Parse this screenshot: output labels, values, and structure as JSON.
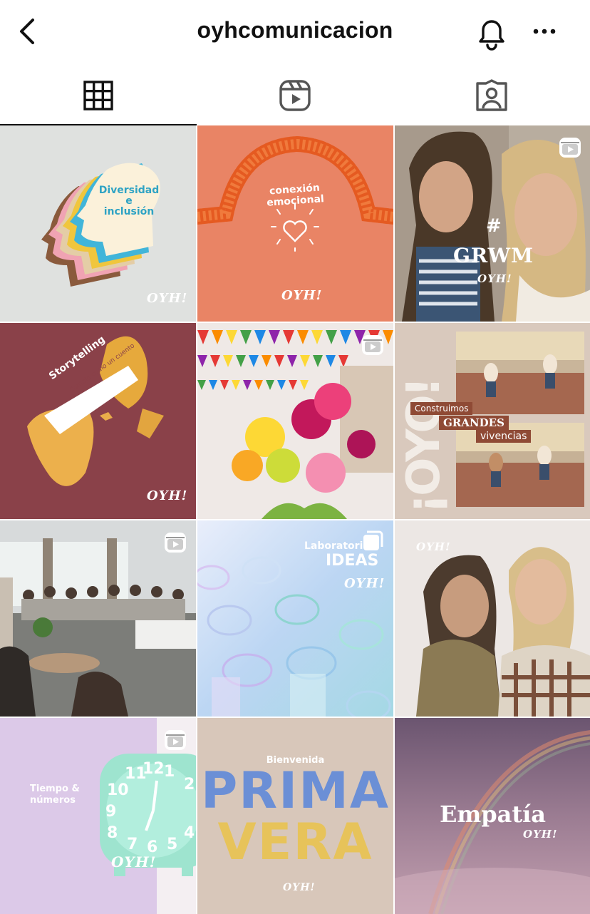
{
  "header": {
    "username": "oyhcomunicacion",
    "back_icon": "back-arrow-icon",
    "bell_icon": "bell-icon",
    "more_icon": "more-horizontal-icon"
  },
  "tabs": [
    {
      "name": "grid",
      "icon": "grid-icon",
      "active": true
    },
    {
      "name": "reels",
      "icon": "reels-icon",
      "active": false
    },
    {
      "name": "tagged",
      "icon": "tagged-user-icon",
      "active": false
    }
  ],
  "posts": {
    "p1": {
      "line1": "Diversidad",
      "line2": "e",
      "line3": "inclusión",
      "brand": "OYH!"
    },
    "p2": {
      "text": "conexión emocional",
      "brand": "OYH!"
    },
    "p3": {
      "hash": "#",
      "text": "GRWM",
      "brand": "OYH!"
    },
    "p4": {
      "text": "Storytelling",
      "sub": "Contalo como un cuento",
      "brand": "OYH!"
    },
    "p5": {},
    "p6": {
      "big": "¡OYO!",
      "l1": "Construimos",
      "l2": "GRANDES",
      "l3": "vivencias"
    },
    "p7": {},
    "p8": {
      "l1": "Laboratorio",
      "l2": "IDEAS",
      "brand": "OYH!"
    },
    "p9": {
      "brand": "OYH!"
    },
    "p10": {
      "l1": "Tiempo &",
      "l2": "números",
      "brand": "OYH!"
    },
    "p11": {
      "top": "Bienvenida",
      "l1": "PRIMA",
      "l2": "VERA",
      "brand": "OYH!"
    },
    "p12": {
      "text": "Empatía",
      "brand": "OYH!"
    }
  },
  "colors": {
    "accent_text": "#111111",
    "tile_2_bg": "#e98465",
    "tile_4_bg": "#8a4149",
    "tile_12_bg": "#8d6a86"
  }
}
